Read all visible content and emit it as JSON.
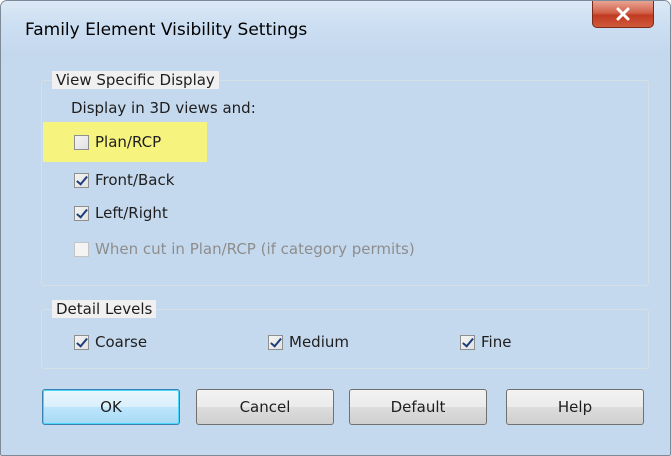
{
  "window": {
    "title": "Family Element Visibility Settings"
  },
  "view_specific": {
    "legend": "View Specific Display",
    "subtitle": "Display in 3D views and:",
    "options": [
      {
        "label": "Plan/RCP",
        "checked": false,
        "enabled": true,
        "highlighted": true
      },
      {
        "label": "Front/Back",
        "checked": true,
        "enabled": true
      },
      {
        "label": "Left/Right",
        "checked": true,
        "enabled": true
      },
      {
        "label": "When cut in Plan/RCP (if category permits)",
        "checked": false,
        "enabled": false
      }
    ]
  },
  "detail_levels": {
    "legend": "Detail Levels",
    "options": [
      {
        "label": "Coarse",
        "checked": true
      },
      {
        "label": "Medium",
        "checked": true
      },
      {
        "label": "Fine",
        "checked": true
      }
    ]
  },
  "buttons": {
    "ok": "OK",
    "cancel": "Cancel",
    "default": "Default",
    "help": "Help"
  },
  "colors": {
    "highlight": "#f6f37e",
    "close_button": "#c13b22",
    "title_bar": "#cddff2"
  }
}
